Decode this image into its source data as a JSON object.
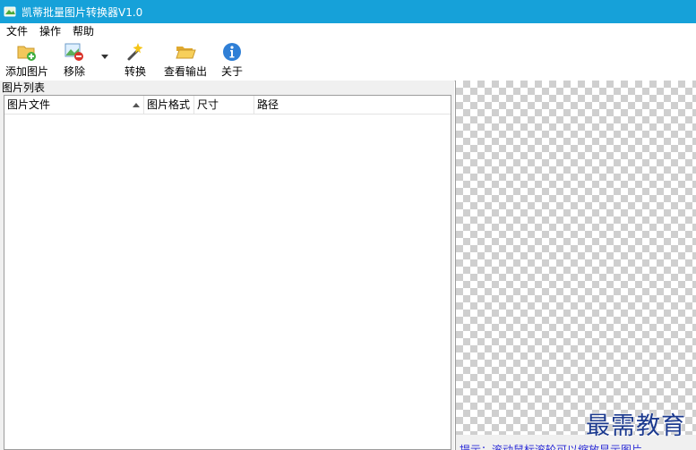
{
  "window": {
    "title": "凯蒂批量图片转换器V1.0"
  },
  "menu": {
    "items": [
      "文件",
      "操作",
      "帮助"
    ]
  },
  "toolbar": {
    "add_label": "添加图片",
    "remove_label": "移除",
    "convert_label": "转换",
    "view_output_label": "查看输出",
    "about_label": "关于"
  },
  "list_panel": {
    "title": "图片列表",
    "columns": [
      "图片文件",
      "图片格式",
      "尺寸",
      "路径"
    ]
  },
  "preview": {
    "hint": "提示：滚动鼠标滚轮可以缩放显示图片"
  },
  "watermark": {
    "text": "最需教育"
  },
  "colors": {
    "titlebar": "#16a1d9",
    "hint_text": "#2b2bd6"
  }
}
